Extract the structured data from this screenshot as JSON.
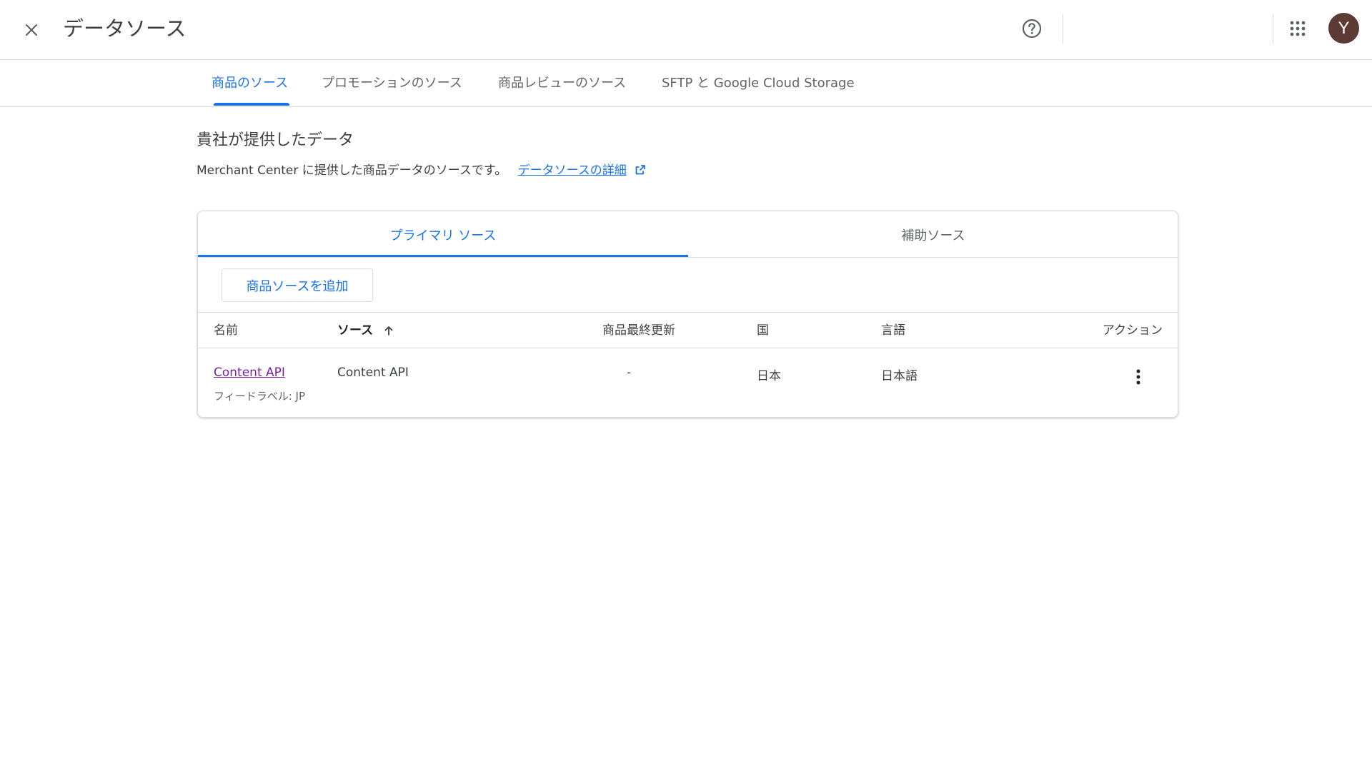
{
  "header": {
    "title": "データソース",
    "avatar_letter": "Y",
    "avatar_color": "#5d3a33"
  },
  "top_tabs": [
    {
      "label": "商品のソース",
      "active": true
    },
    {
      "label": "プロモーションのソース",
      "active": false
    },
    {
      "label": "商品レビューのソース",
      "active": false
    },
    {
      "label": "SFTP と Google Cloud Storage",
      "active": false
    }
  ],
  "section": {
    "heading": "貴社が提供したデータ",
    "description": "Merchant Center に提供した商品データのソースです。",
    "link_label": "データソースの詳細"
  },
  "card": {
    "tabs": [
      {
        "label": "プライマリ ソース",
        "active": true
      },
      {
        "label": "補助ソース",
        "active": false
      }
    ],
    "add_button_label": "商品ソースを追加",
    "columns": {
      "name": "名前",
      "source": "ソース",
      "products": "商品",
      "last_updated": "最終更新",
      "country": "国",
      "language": "言語",
      "actions": "アクション"
    },
    "rows": [
      {
        "name": "Content API",
        "feed_label": "フィードラベル: JP",
        "source": "Content API",
        "products": "",
        "last_updated": "-",
        "country": "日本",
        "language": "日本語"
      }
    ]
  },
  "colors": {
    "accent": "#1a73e8",
    "visited_link": "#7b1fa2",
    "divider": "#dadce0"
  },
  "icons": [
    "close-icon",
    "help-icon",
    "apps-grid-icon",
    "external-link-icon",
    "sort-arrow-up-icon",
    "more-vert-icon"
  ]
}
